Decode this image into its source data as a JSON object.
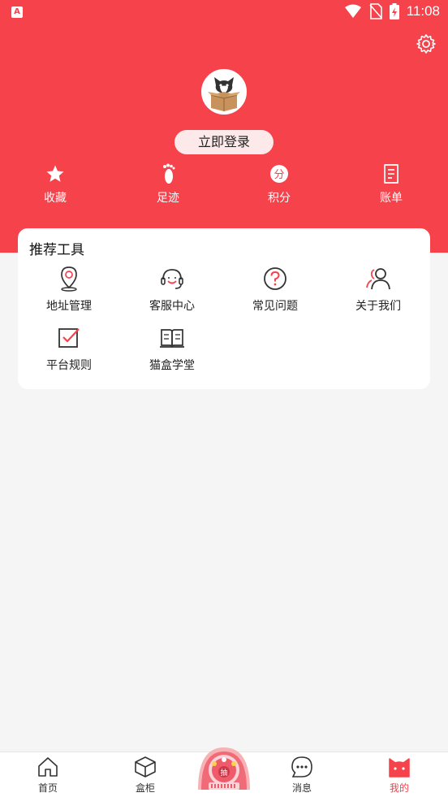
{
  "status_bar": {
    "time": "11:08",
    "app_icon": "A"
  },
  "header": {
    "settings_icon": "gear-icon",
    "login_label": "立即登录",
    "quick_links": [
      {
        "label": "收藏",
        "icon": "star-icon"
      },
      {
        "label": "足迹",
        "icon": "footprint-icon"
      },
      {
        "label": "积分",
        "icon": "points-icon",
        "badge": "分"
      },
      {
        "label": "账单",
        "icon": "bill-icon"
      }
    ]
  },
  "tools": {
    "title": "推荐工具",
    "items": [
      {
        "label": "地址管理",
        "icon": "location-icon"
      },
      {
        "label": "客服中心",
        "icon": "headset-icon"
      },
      {
        "label": "常见问题",
        "icon": "question-icon"
      },
      {
        "label": "关于我们",
        "icon": "people-icon"
      },
      {
        "label": "平台规则",
        "icon": "checkbox-icon"
      },
      {
        "label": "猫盒学堂",
        "icon": "book-icon"
      }
    ]
  },
  "tabbar": {
    "items": [
      {
        "label": "首页",
        "icon": "home-icon"
      },
      {
        "label": "盒柜",
        "icon": "box-icon"
      },
      {
        "label": "消息",
        "icon": "chat-icon"
      },
      {
        "label": "我的",
        "icon": "cat-icon"
      }
    ],
    "center_badge": "抽",
    "active": "我的"
  },
  "colors": {
    "brand": "#f5424b",
    "background": "#f5f5f5"
  }
}
